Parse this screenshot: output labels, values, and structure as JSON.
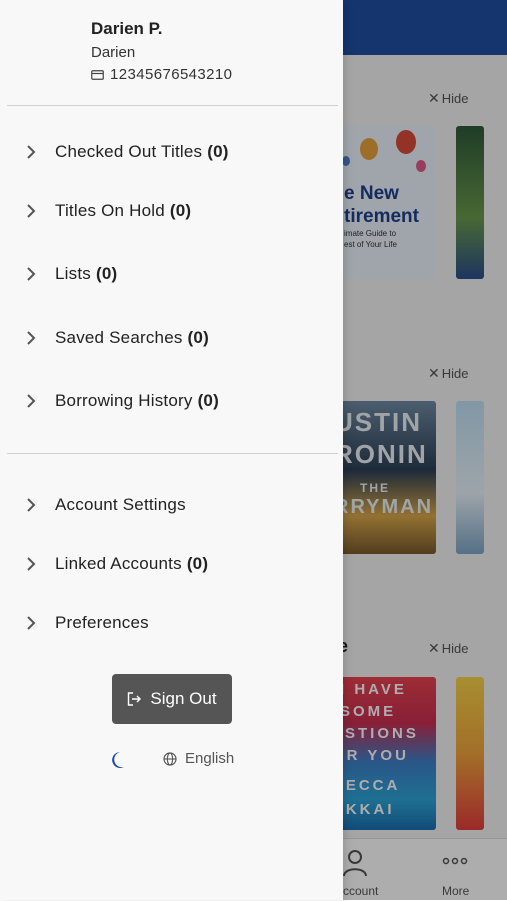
{
  "user": {
    "name": "Darien P.",
    "location": "Darien",
    "card_number": "12345676543210"
  },
  "menu": {
    "primary": [
      {
        "label": "Checked Out Titles",
        "count": "(0)"
      },
      {
        "label": "Titles On Hold",
        "count": "(0)"
      },
      {
        "label": "Lists",
        "count": "(0)"
      },
      {
        "label": "Saved Searches",
        "count": "(0)"
      },
      {
        "label": "Borrowing History",
        "count": "(0)"
      }
    ],
    "secondary": [
      {
        "label": "Account Settings",
        "count": ""
      },
      {
        "label": "Linked Accounts",
        "count": "(0)"
      },
      {
        "label": "Preferences",
        "count": ""
      }
    ]
  },
  "sign_out_label": "Sign Out",
  "language": "English",
  "background": {
    "hide_label": "Hide",
    "section_letter": "e",
    "covers": {
      "a_title": "e New\ntirement",
      "a_sub": "imate Guide to\nest of Your Life",
      "c_lines": [
        "USTIN",
        "RONIN",
        "THE",
        "RRYMAN"
      ],
      "e_lines": [
        "I HAVE",
        "SOME",
        "ESTIONS",
        "OR YOU",
        "BECCA",
        "AKKAI"
      ]
    },
    "tabs": {
      "account": "ccount",
      "more": "More"
    }
  },
  "colors": {
    "header_blue": "#1f4fa3",
    "signout_bg": "#555555",
    "moon_blue": "#1f4fa3"
  }
}
